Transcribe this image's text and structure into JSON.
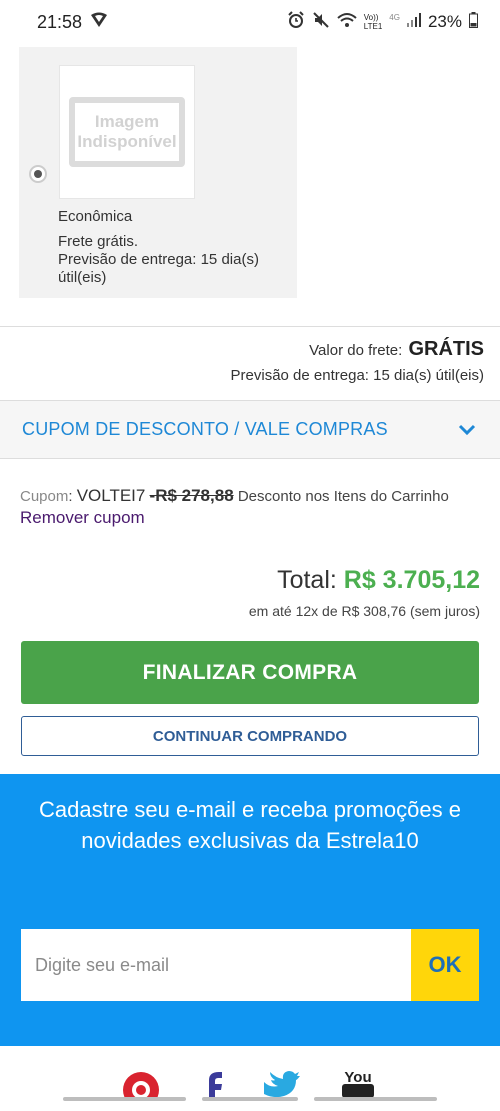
{
  "status_bar": {
    "time": "21:58",
    "battery": "23%",
    "volte": "Vo))",
    "lte": "LTE1",
    "network": "4G"
  },
  "shipping_option": {
    "image_placeholder_line1": "Imagem",
    "image_placeholder_line2": "Indisponível",
    "name": "Econômica",
    "detail_line1": "Frete grátis.",
    "detail_line2": "Previsão de entrega: 15 dia(s) útil(eis)",
    "selected": true
  },
  "freight_summary": {
    "label": "Valor do frete:",
    "value": "GRÁTIS",
    "delivery": "Previsão de entrega: 15 dia(s) útil(eis)"
  },
  "coupon_section": {
    "title": "CUPOM DE DESCONTO / VALE COMPRAS",
    "label": "Cupom",
    "separator": ":",
    "code": "VOLTEI7",
    "discount": "-R$ 278,88",
    "discount_note": "Desconto nos Itens do Carrinho",
    "remove_label": "Remover cupom"
  },
  "totals": {
    "label": "Total:",
    "amount": "R$ 3.705,12",
    "installments": "em até 12x de R$ 308,76 (sem juros)"
  },
  "actions": {
    "finish": "FINALIZAR COMPRA",
    "continue": "CONTINUAR COMPRANDO"
  },
  "newsletter": {
    "message": "Cadastre seu e-mail e receba promoções e novidades exclusivas da Estrela10",
    "email_placeholder": "Digite seu e-mail",
    "ok_label": "OK"
  },
  "social": {
    "youtube_text": "You",
    "icons": [
      "pinterest-icon",
      "facebook-icon",
      "twitter-icon",
      "youtube-icon"
    ]
  },
  "colors": {
    "accent_blue": "#1e88d6",
    "green": "#4aa34a",
    "newsletter_bg": "#0f95f0",
    "ok_yellow": "#ffd60a"
  }
}
